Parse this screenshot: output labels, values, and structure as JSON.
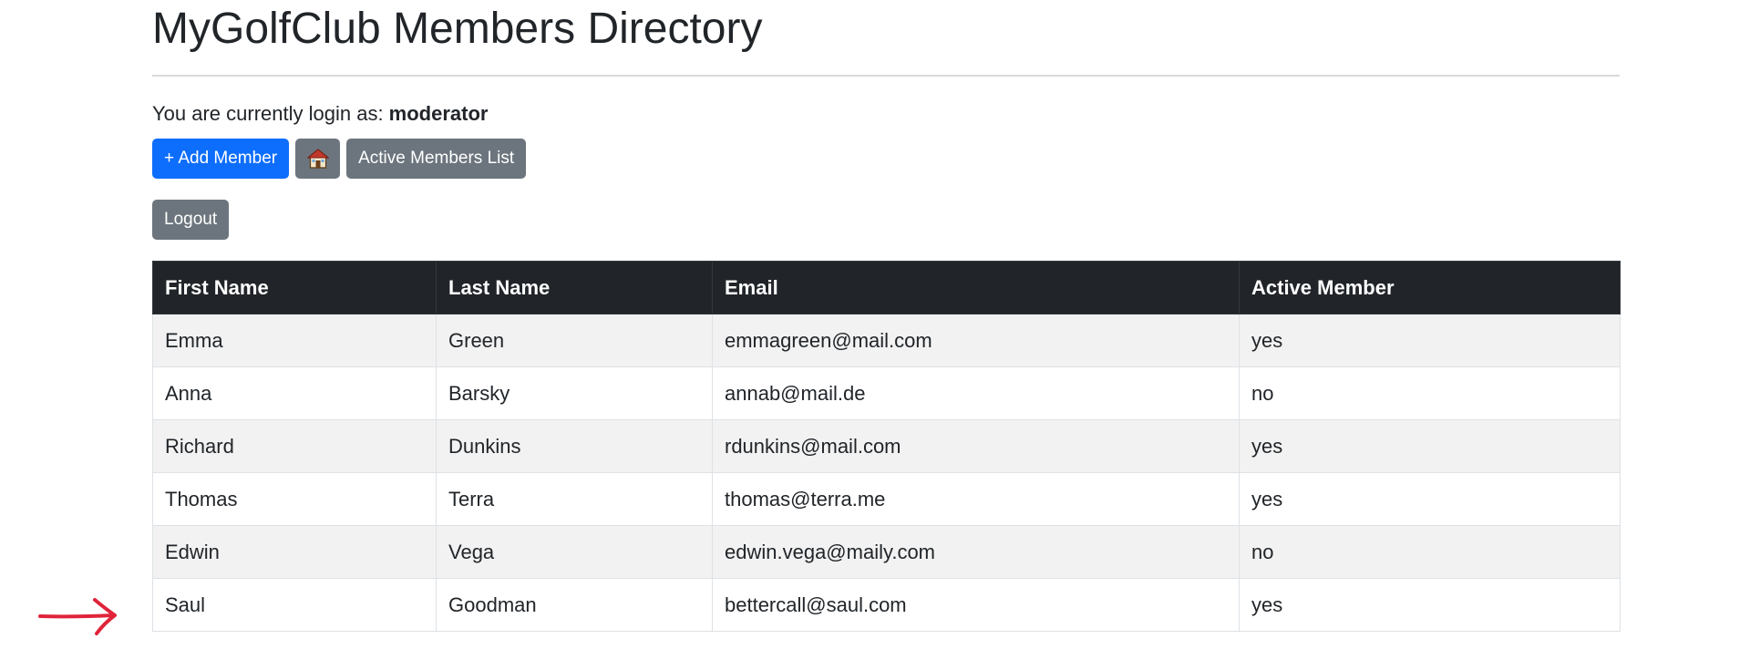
{
  "page": {
    "title": "MyGolfClub Members Directory",
    "login_prefix": "You are currently login as: ",
    "login_user": "moderator"
  },
  "toolbar": {
    "add_member_label": "+ Add Member",
    "home_icon": "house-icon",
    "active_list_label": "Active Members List",
    "logout_label": "Logout"
  },
  "colors": {
    "primary": "#0d6efd",
    "secondary": "#6c757d",
    "table_header": "#212529",
    "annotation_arrow": "#e0243a"
  },
  "table": {
    "headers": [
      "First Name",
      "Last Name",
      "Email",
      "Active Member"
    ],
    "rows": [
      [
        "Emma",
        "Green",
        "emmagreen@mail.com",
        "yes"
      ],
      [
        "Anna",
        "Barsky",
        "annab@mail.de",
        "no"
      ],
      [
        "Richard",
        "Dunkins",
        "rdunkins@mail.com",
        "yes"
      ],
      [
        "Thomas",
        "Terra",
        "thomas@terra.me",
        "yes"
      ],
      [
        "Edwin",
        "Vega",
        "edwin.vega@maily.com",
        "no"
      ],
      [
        "Saul",
        "Goodman",
        "bettercall@saul.com",
        "yes"
      ]
    ]
  },
  "annotation": {
    "icon": "arrow-right-icon",
    "points_to_row": 6
  }
}
